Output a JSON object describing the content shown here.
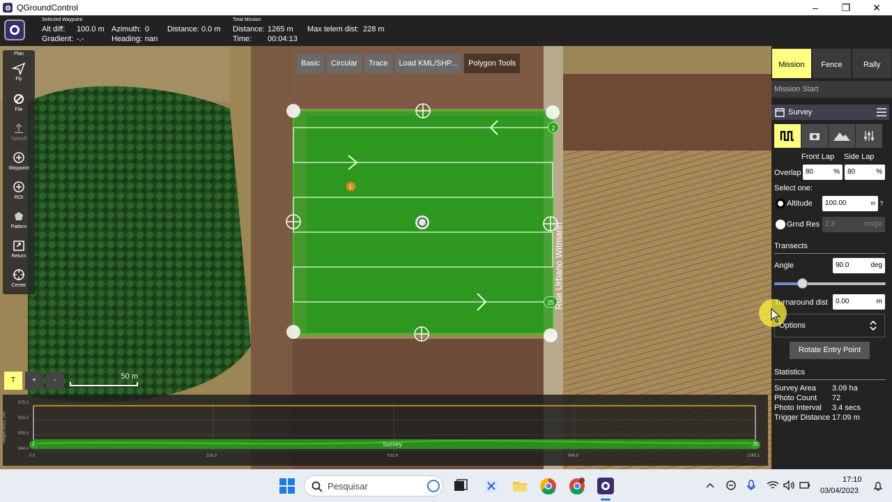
{
  "window": {
    "title": "QGroundControl"
  },
  "topbar": {
    "selected_waypoint_label": "Selected Waypoint",
    "alt_diff_label": "Alt diff:",
    "alt_diff": "100.0 m",
    "azimuth_label": "Azimuth:",
    "azimuth": "0",
    "distance_label": "Distance:",
    "distance": "0.0 m",
    "gradient_label": "Gradient:",
    "gradient": "-.-",
    "heading_label": "Heading:",
    "heading": "nan",
    "total_mission_label": "Total Mission",
    "total_distance_label": "Distance:",
    "total_distance": "1265 m",
    "time_label": "Time:",
    "time": "00:04:13",
    "max_telem_label": "Max telem dist:",
    "max_telem": "228 m"
  },
  "leftbar": {
    "items": [
      {
        "label": "Plan",
        "icon": "plan-icon"
      },
      {
        "label": "Fly",
        "icon": "fly-icon"
      },
      {
        "label": "File",
        "icon": "file-icon"
      },
      {
        "label": "Takeoff",
        "icon": "takeoff-icon"
      },
      {
        "label": "Waypoint",
        "icon": "waypoint-icon"
      },
      {
        "label": "ROI",
        "icon": "roi-icon"
      },
      {
        "label": "Pattern",
        "icon": "pattern-icon"
      },
      {
        "label": "Return",
        "icon": "return-icon"
      },
      {
        "label": "Center",
        "icon": "center-icon"
      }
    ]
  },
  "polygon_tools": {
    "buttons": [
      "Basic",
      "Circular",
      "Trace",
      "Load KML/SHP..."
    ],
    "label": "Polygon Tools"
  },
  "map": {
    "street_label": "Rua Urbano Witmann",
    "waypoint_start": "2",
    "waypoint_end": "25",
    "launch_marker": "L",
    "zoom_buttons": [
      "T",
      "+",
      "-"
    ],
    "scale_label": "50 m"
  },
  "profile": {
    "ylabel": "Height AMSL (m)",
    "yticks": [
      "975.0",
      "933.5",
      "909.0",
      "844.4"
    ],
    "xticks": [
      "0.0",
      "316.3",
      "632.6",
      "948.9",
      "1265.1"
    ],
    "series_label": "Survey",
    "start_marker": "2",
    "end_marker": "25"
  },
  "rightpanel": {
    "tabs": [
      "Mission",
      "Fence",
      "Rally"
    ],
    "mission_start": "Mission Start",
    "survey_title": "Survey",
    "front_lap_label": "Front Lap",
    "side_lap_label": "Side Lap",
    "overlap_label": "Overlap",
    "front_lap": "80",
    "side_lap": "80",
    "percent_unit": "%",
    "select_one_label": "Select one:",
    "altitude_label": "Altitude",
    "altitude": "100.00",
    "altitude_unit": "m",
    "help_label": "?",
    "grnd_res_label": "Grnd Res",
    "grnd_res": "2.3",
    "grnd_res_unit": "cm/px",
    "transects_label": "Transects",
    "angle_label": "Angle",
    "angle": "90.0",
    "angle_unit": "deg",
    "angle_slider_fraction": 0.25,
    "turnaround_label": "Turnaround dist",
    "turnaround": "0.00",
    "turnaround_unit": "m",
    "options_label": "Options",
    "rotate_button": "Rotate Entry Point",
    "statistics_label": "Statistics",
    "stats": [
      {
        "label": "Survey Area",
        "value": "3.09 ha"
      },
      {
        "label": "Photo Count",
        "value": "72"
      },
      {
        "label": "Photo Interval",
        "value": "3.4 secs"
      },
      {
        "label": "Trigger Distance",
        "value": "17.09 m"
      }
    ]
  },
  "taskbar": {
    "search_placeholder": "Pesquisar",
    "time": "17:10",
    "date": "03/04/2023"
  },
  "colors": {
    "accent": "#ffff80",
    "survey_green": "#2e9e1f",
    "profile_line": "#e8a317"
  }
}
